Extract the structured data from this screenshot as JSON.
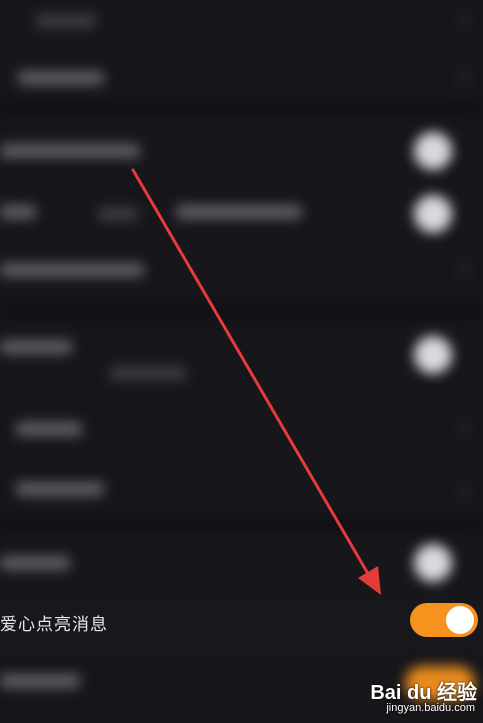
{
  "setting": {
    "label": "爱心点亮消息",
    "toggle_on": true
  },
  "colors": {
    "background": "#16161b",
    "toggle_on": "#f5931e",
    "toggle_knob": "#ffffff",
    "label_text": "#e8e8ec",
    "annotation_arrow": "#e53b3b"
  },
  "watermark": {
    "brand": "Bai du 经验",
    "url": "jingyan.baidu.com"
  }
}
